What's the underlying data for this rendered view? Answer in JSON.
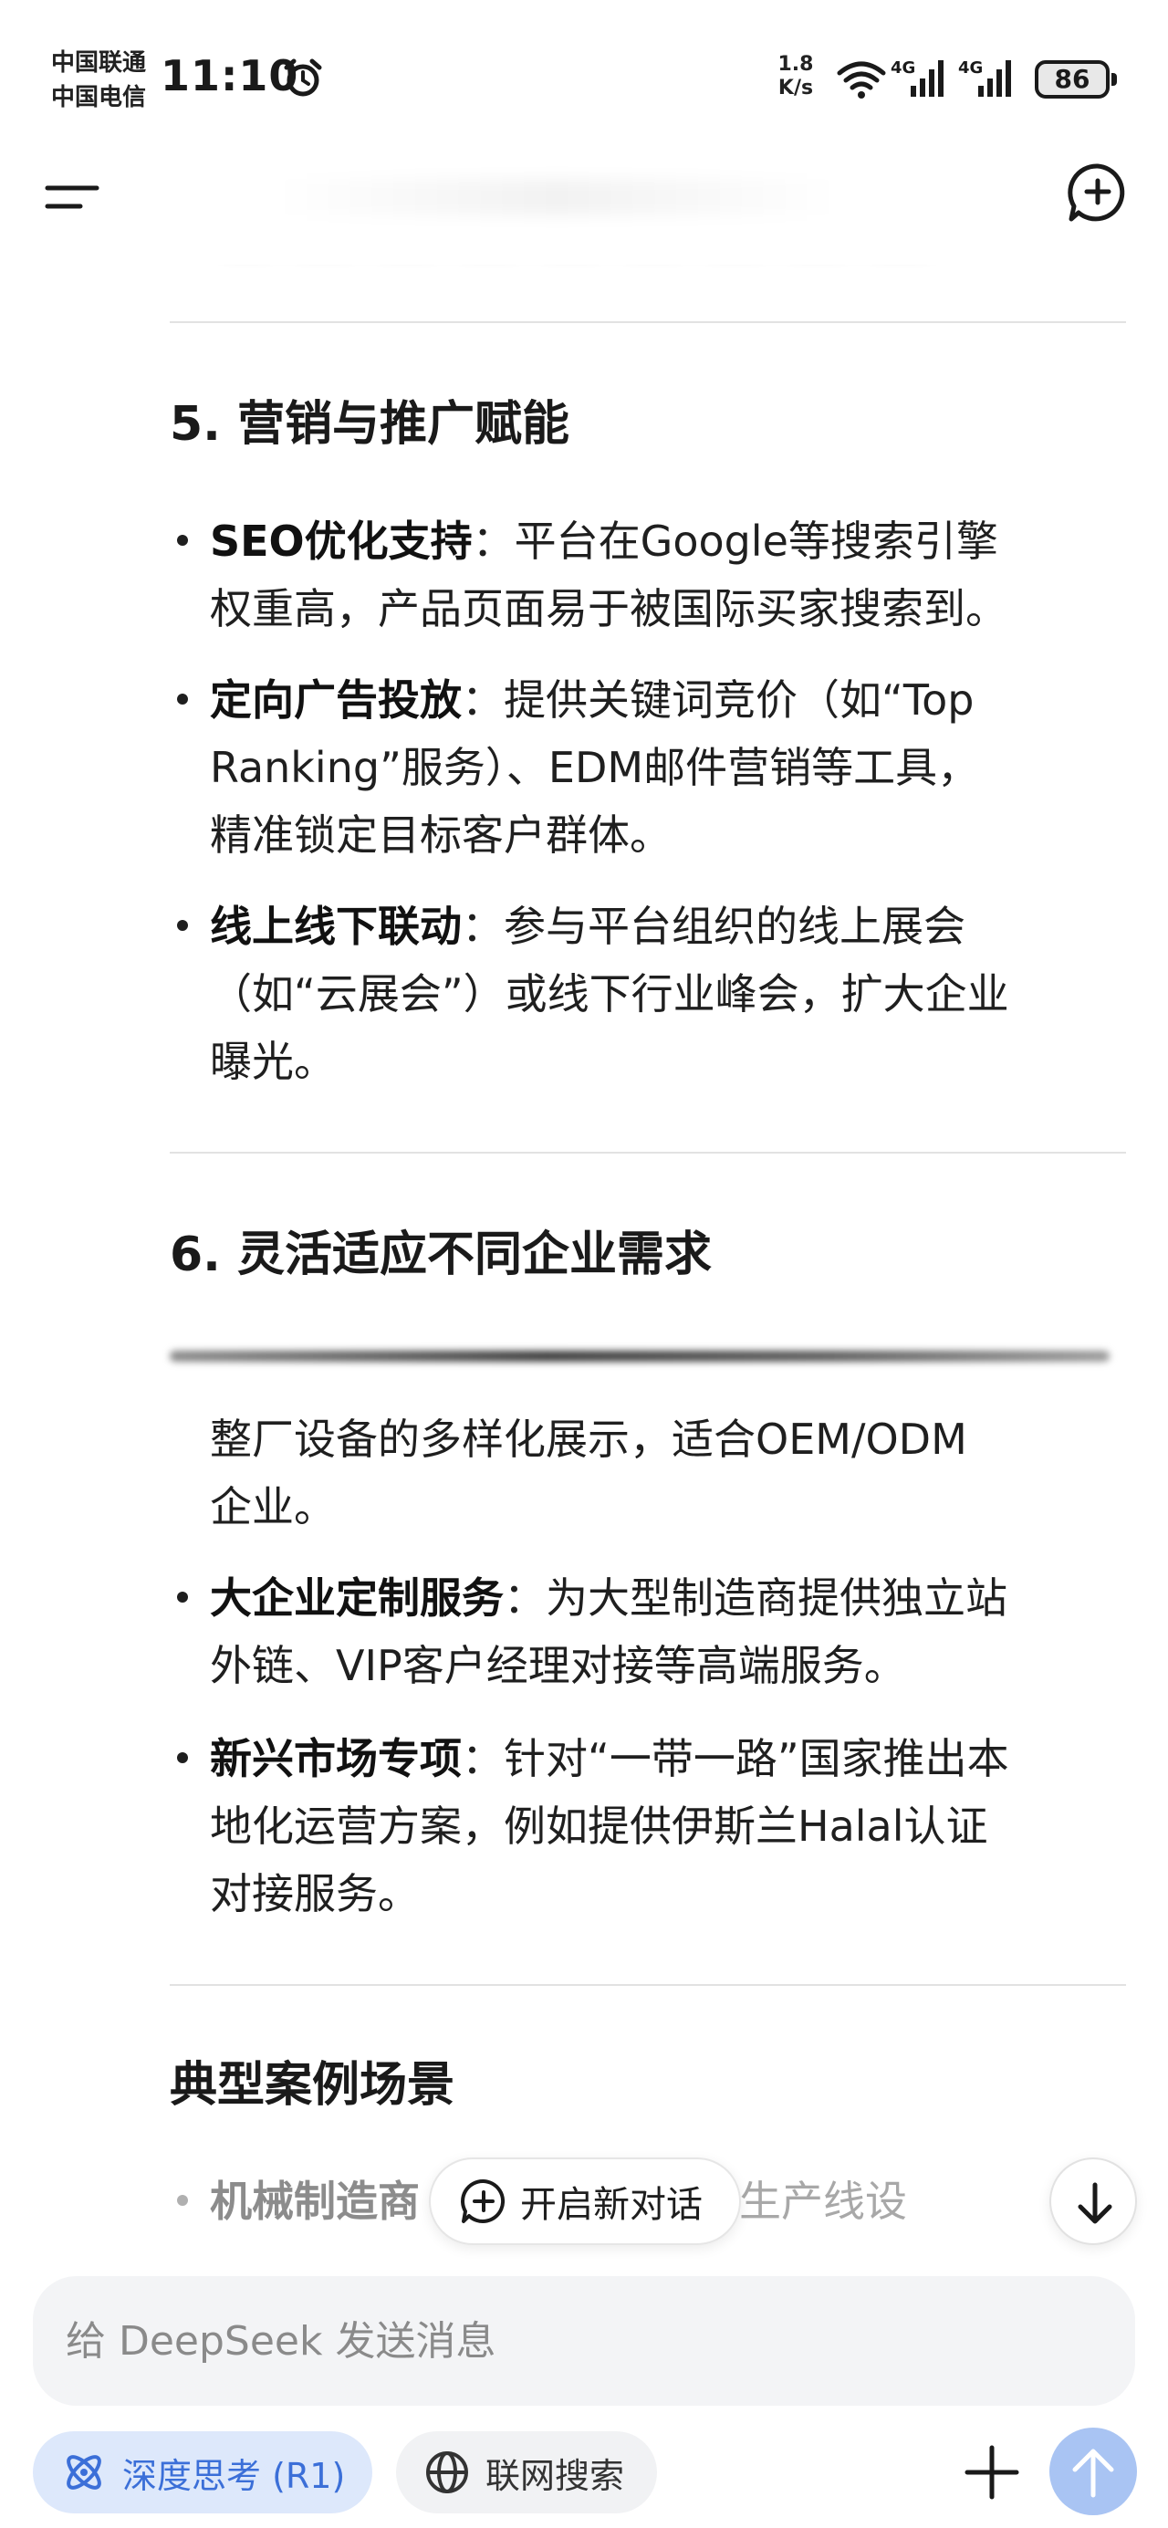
{
  "status_bar": {
    "carrier_1": "中国联通",
    "carrier_2": "中国电信",
    "time": "11:10",
    "net_speed_value": "1.8",
    "net_speed_unit": "K/s",
    "signal_1_label": "4G",
    "signal_2_label": "4G",
    "battery": "86"
  },
  "content": {
    "section_5_title": "5. 营销与推广赋能",
    "section_5_items": [
      {
        "bold": "SEO优化支持",
        "line1": "：平台在Google等搜索引擎",
        "line2": "权重高，产品页面易于被国际买家搜索到。"
      },
      {
        "bold": "定向广告投放",
        "line1": "：提供关键词竞价（如“Top",
        "line2": "Ranking”服务）、EDM邮件营销等工具，",
        "line3": "精准锁定目标客户群体。"
      },
      {
        "bold": "线上线下联动",
        "line1": "：参与平台组织的线上展会",
        "line2": "（如“云展会”）或线下行业峰会，扩大企业",
        "line3": "曝光。"
      }
    ],
    "section_6_title": "6. 灵活适应不同企业需求",
    "section_6_continued_line1": "整厂设备的多样化展示，适合OEM/ODM",
    "section_6_continued_line2": "企业。",
    "section_6_items": [
      {
        "bold": "大企业定制服务",
        "line1": "：为大型制造商提供独立站",
        "line2": "外链、VIP客户经理对接等高端服务。"
      },
      {
        "bold": "新兴市场专项",
        "line1": "：针对“一带一路”国家推出本",
        "line2": "地化运营方案，例如提供伊斯兰Halal认证",
        "line3": "对接服务。"
      }
    ],
    "cases_title": "典型案例场景",
    "partial_item_bold": "机械制造商",
    "partial_item_rest": "展示生产线设"
  },
  "floating": {
    "new_chat_label": "开启新对话"
  },
  "composer": {
    "placeholder": "给 DeepSeek 发送消息",
    "deep_think_label": "深度思考 (R1)",
    "web_search_label": "联网搜索"
  },
  "colors": {
    "accent": "#3b6fd8",
    "deep_chip_bg": "#dde8fb",
    "send_button": "#a9c4f3"
  }
}
